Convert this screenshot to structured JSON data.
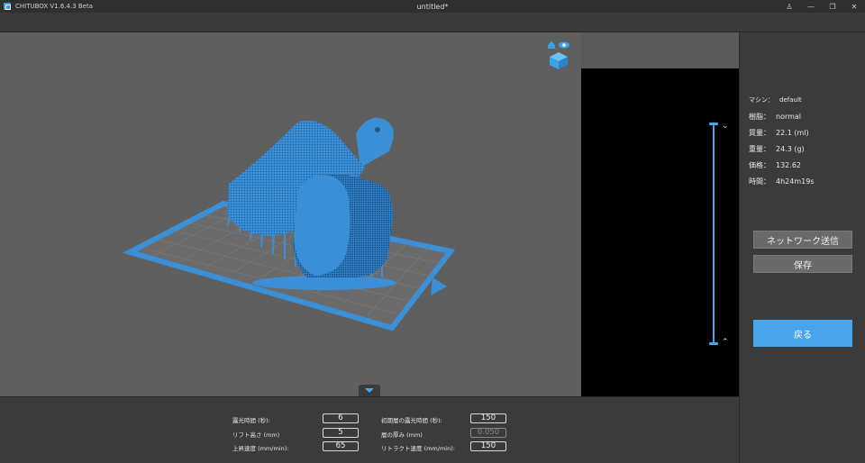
{
  "window": {
    "app_name": "CHITUBOX V1.6.4.3 Beta",
    "doc_title": "untitled*",
    "controls": {
      "user": "♙",
      "minimize": "—",
      "restore": "❐",
      "close": "✕"
    }
  },
  "info": {
    "machine": {
      "label": "マシン：",
      "value": "default"
    },
    "resin": {
      "label": "樹脂：",
      "value": "normal"
    },
    "volume": {
      "label": "質量：",
      "value": "22.1  (ml)"
    },
    "weight": {
      "label": "重量：",
      "value": "24.3  (g)"
    },
    "price": {
      "label": "価格：",
      "value": "132.62"
    },
    "time": {
      "label": "時間：",
      "value": "4h24m19s"
    }
  },
  "buttons": {
    "network_send": "ネットワーク送信",
    "save": "保存",
    "back": "戻る"
  },
  "slider": {
    "up": "⌄",
    "down": "⌃"
  },
  "params": {
    "exposure_time": {
      "label": "露光時間 (秒):",
      "value": "6"
    },
    "lift_height": {
      "label": "リフト高さ (mm)",
      "value": "5"
    },
    "lift_speed": {
      "label": "上昇速度 (mm/min):",
      "value": "65"
    },
    "bottom_exposure": {
      "label": "初期層の露光時間 (秒):",
      "value": "150"
    },
    "layer_height": {
      "label": "層の厚み (mm)",
      "value": "0.050"
    },
    "retract_speed": {
      "label": "リトラクト速度 (mm/min):",
      "value": "150"
    }
  },
  "colors": {
    "accent": "#4aa6ec",
    "model": "#3a8fd6",
    "viewport": "#5f5f5f",
    "panel": "#3b3b3b"
  }
}
